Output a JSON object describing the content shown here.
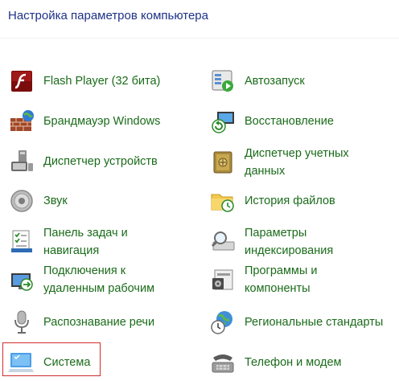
{
  "header": {
    "title": "Настройка параметров компьютера"
  },
  "left_column": [
    {
      "id": "flash",
      "line1": "Flash Player (32 бита)",
      "line2": "",
      "icon": "flash-player-icon"
    },
    {
      "id": "firewall",
      "line1": "Брандмауэр Windows",
      "line2": "",
      "icon": "firewall-icon"
    },
    {
      "id": "device-manager",
      "line1": "Диспетчер устройств",
      "line2": "",
      "icon": "device-manager-icon"
    },
    {
      "id": "sound",
      "line1": "Звук",
      "line2": "",
      "icon": "speaker-icon"
    },
    {
      "id": "taskbar",
      "line1": "Панель задач и",
      "line2": "навигация",
      "icon": "taskbar-icon"
    },
    {
      "id": "remote",
      "line1": "Подключения к",
      "line2": "удаленным рабочим",
      "icon": "remote-desktop-icon"
    },
    {
      "id": "speech",
      "line1": "Распознавание речи",
      "line2": "",
      "icon": "microphone-icon"
    },
    {
      "id": "system",
      "line1": "Система",
      "line2": "",
      "icon": "system-monitor-icon"
    }
  ],
  "right_column": [
    {
      "id": "autoplay",
      "line1": "Автозапуск",
      "line2": "",
      "icon": "autoplay-icon"
    },
    {
      "id": "recovery",
      "line1": "Восстановление",
      "line2": "",
      "icon": "recovery-icon"
    },
    {
      "id": "credentials",
      "line1": "Диспетчер учетных",
      "line2": "данных",
      "icon": "credential-safe-icon"
    },
    {
      "id": "file-history",
      "line1": "История файлов",
      "line2": "",
      "icon": "file-history-icon"
    },
    {
      "id": "indexing",
      "line1": "Параметры",
      "line2": "индексирования",
      "icon": "indexing-icon"
    },
    {
      "id": "programs",
      "line1": "Программы и",
      "line2": "компоненты",
      "icon": "programs-icon"
    },
    {
      "id": "region",
      "line1": "Региональные стандарты",
      "line2": "",
      "icon": "globe-clock-icon"
    },
    {
      "id": "phone-modem",
      "line1": "Телефон и модем",
      "line2": "",
      "icon": "telephone-icon"
    }
  ],
  "colors": {
    "title": "#1e3287",
    "link": "#1a6b1a",
    "highlight_border": "#d42b2b"
  }
}
